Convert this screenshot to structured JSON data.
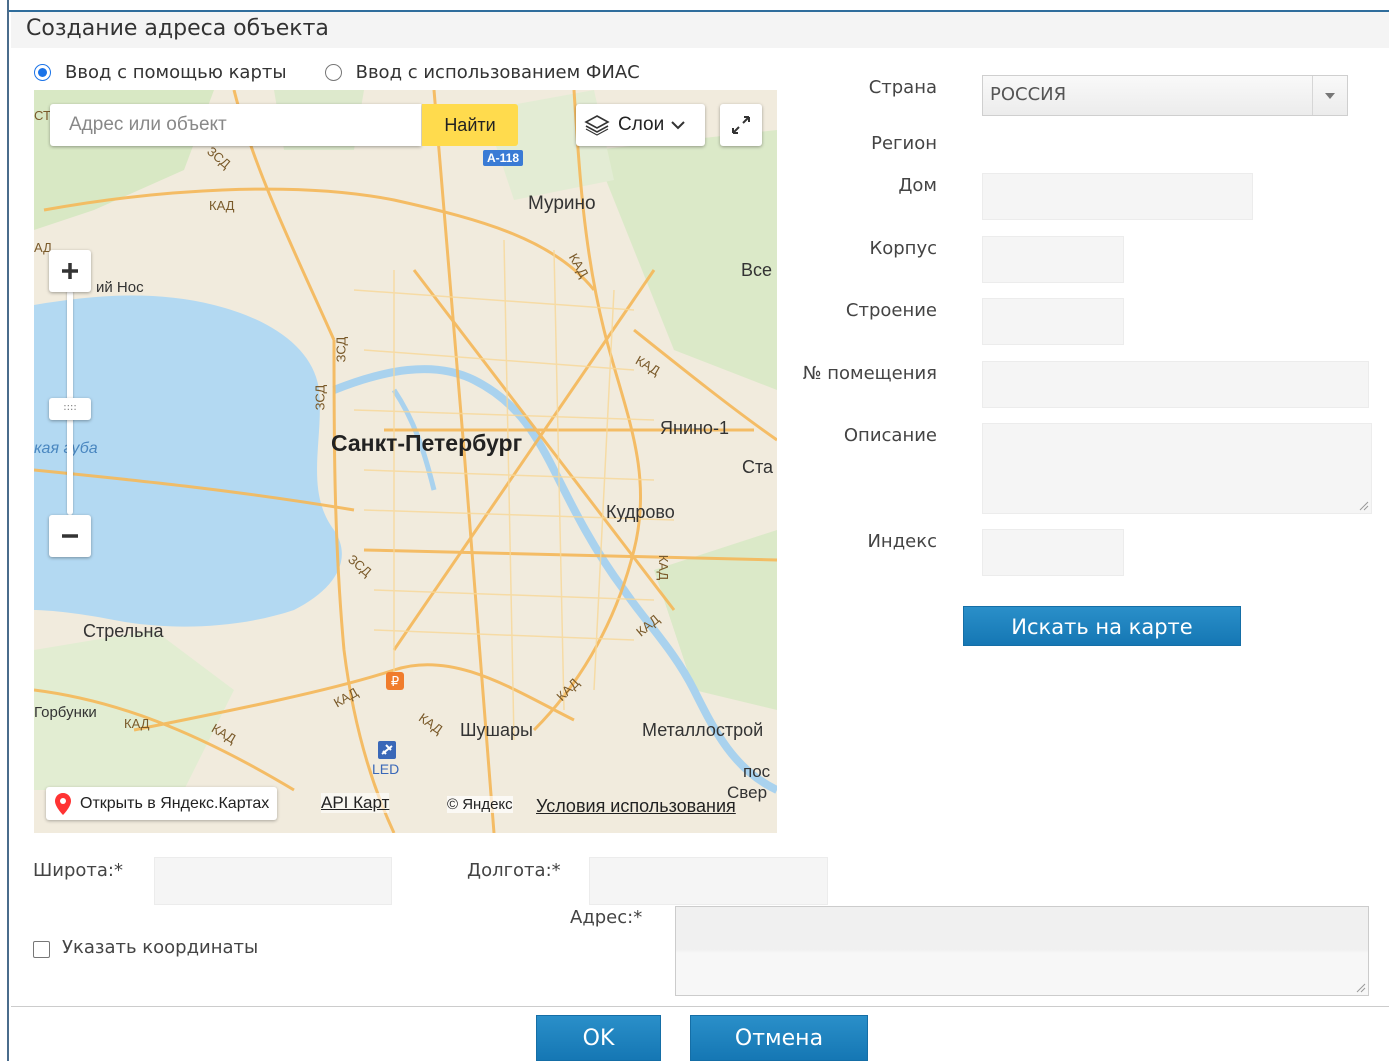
{
  "dialog": {
    "title": "Создание адреса объекта"
  },
  "input_mode": {
    "option_map": "Ввод с помощью карты",
    "option_fias": "Ввод с использованием ФИАС",
    "selected": "map"
  },
  "map": {
    "search_placeholder": "Адрес или объект",
    "find_label": "Найти",
    "layers_label": "Слои",
    "route_badge": "А-118",
    "open_in_yandex": "Открыть в Яндекс.Картах",
    "api_link": "API Карт",
    "copyright": "© Яндекс",
    "terms": "Условия использования",
    "zoom_handle": "::::",
    "place_labels": {
      "spb": "Санкт-Петербург",
      "murino": "Мурино",
      "yanino": "Янино-1",
      "kudrovo": "Кудрово",
      "strelna": "Стрельна",
      "shushary": "Шушары",
      "metallostroy": "Металлострой",
      "gorbunki": "Горбунки",
      "led": "LED",
      "nos": "ий Нос",
      "gulf": "кая губа",
      "vse": "Все",
      "sta": "Ста",
      "pos": "пос",
      "sver": "Свер",
      "kad1": "КАД",
      "kad2": "КАД",
      "kad3": "КАД",
      "kad4": "КАД",
      "kad5": "КАД",
      "kad6": "КАД",
      "kad7": "КАД",
      "kad8": "КАД",
      "kad9": "КАД",
      "kad10": "КАД",
      "zsd1": "ЗСД",
      "zsd2": "ЗСД",
      "zsd3": "ЗСД",
      "zsd4": "ЗСД",
      "ad": "АД",
      "ct": "СТ"
    }
  },
  "address_form": {
    "country_label": "Страна",
    "country_value": "РОССИЯ",
    "region_label": "Регион",
    "house_label": "Дом",
    "corpus_label": "Корпус",
    "building_label": "Строение",
    "room_label": "№ помещения",
    "description_label": "Описание",
    "index_label": "Индекс",
    "search_on_map": "Искать на карте"
  },
  "coords": {
    "lat_label": "Широта:*",
    "lon_label": "Долгота:*",
    "address_label": "Адрес:*",
    "specify_coords": "Указать координаты"
  },
  "footer": {
    "ok": "OK",
    "cancel": "Отмена"
  },
  "colors": {
    "primary_button": "#1a7fbf",
    "find_button": "#ffdb4d",
    "water": "#b3d9f2",
    "map_roads": "#f7c96b"
  }
}
